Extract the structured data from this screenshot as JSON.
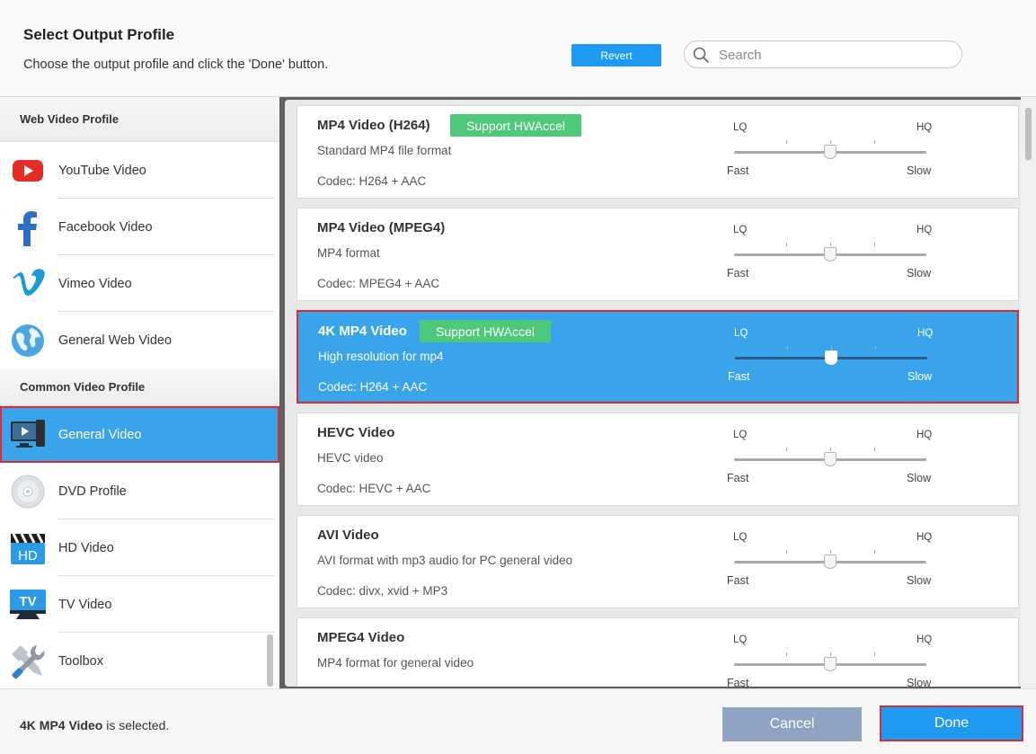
{
  "header": {
    "title": "Select Output Profile",
    "subtitle": "Choose the output profile and click the 'Done' button.",
    "revert_label": "Revert",
    "search_placeholder": "Search",
    "search_value": ""
  },
  "sidebar": {
    "web_header": "Web Video Profile",
    "web_items": [
      {
        "label": "YouTube Video",
        "icon": "youtube-icon"
      },
      {
        "label": "Facebook Video",
        "icon": "facebook-icon"
      },
      {
        "label": "Vimeo Video",
        "icon": "vimeo-icon"
      },
      {
        "label": "General Web Video",
        "icon": "globe-icon"
      }
    ],
    "common_header": "Common Video Profile",
    "common_items": [
      {
        "label": "General Video",
        "icon": "monitor-play-icon",
        "selected": true
      },
      {
        "label": "DVD Profile",
        "icon": "disc-icon"
      },
      {
        "label": "HD Video",
        "icon": "hd-clapper-icon"
      },
      {
        "label": "TV Video",
        "icon": "tv-icon"
      },
      {
        "label": "Toolbox",
        "icon": "wrench-screwdriver-icon"
      }
    ]
  },
  "quality_labels": {
    "lq": "LQ",
    "hq": "HQ",
    "fast": "Fast",
    "slow": "Slow"
  },
  "profiles": [
    {
      "name": "MP4 Video (H264)",
      "badge": "Support HWAccel",
      "desc": "Standard MP4 file format",
      "codec": "Codec: H264 + AAC",
      "quality": 0.5
    },
    {
      "name": "MP4 Video (MPEG4)",
      "badge": "",
      "desc": "MP4 format",
      "codec": "Codec: MPEG4 + AAC",
      "quality": 0.5
    },
    {
      "name": "4K MP4 Video",
      "badge": "Support HWAccel",
      "desc": "High resolution for mp4",
      "codec": "Codec: H264 + AAC",
      "quality": 0.5,
      "selected": true
    },
    {
      "name": "HEVC Video",
      "badge": "",
      "desc": "HEVC video",
      "codec": "Codec: HEVC + AAC",
      "quality": 0.5
    },
    {
      "name": "AVI Video",
      "badge": "",
      "desc": "AVI format with mp3 audio for PC general video",
      "codec": "Codec: divx, xvid + MP3",
      "quality": 0.5
    },
    {
      "name": "MPEG4 Video",
      "badge": "",
      "desc": "MP4 format for general video",
      "codec": "",
      "quality": 0.5
    }
  ],
  "footer": {
    "selected_name": "4K MP4 Video",
    "selected_suffix": " is selected.",
    "cancel_label": "Cancel",
    "done_label": "Done"
  },
  "colors": {
    "accent": "#1e9bf0",
    "selection": "#3aa4ea",
    "highlight_border": "#d62d3a",
    "badge": "#4ec97a"
  }
}
